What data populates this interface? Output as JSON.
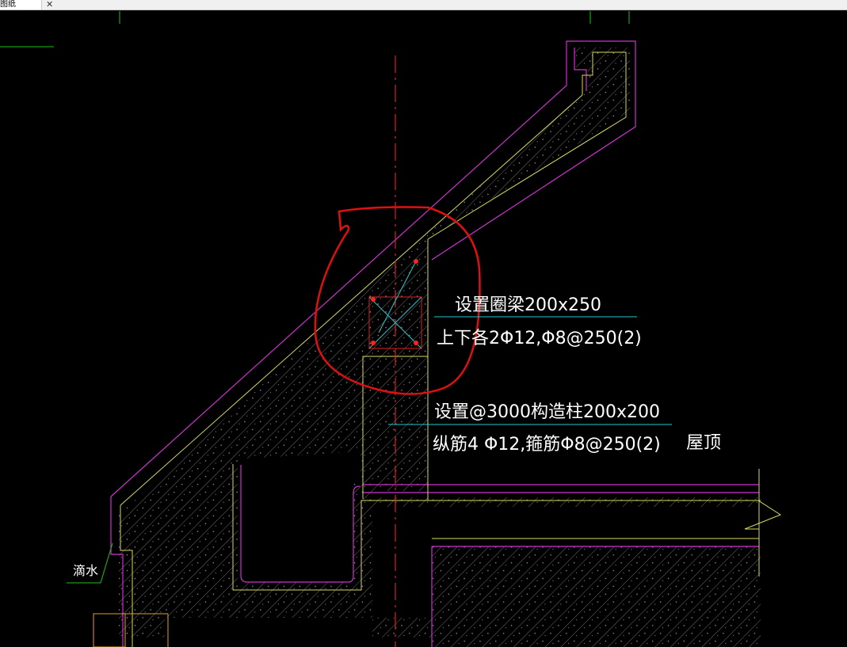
{
  "window": {
    "tab_label": "图纸",
    "tab_close": "✕"
  },
  "colors": {
    "background": "#000000",
    "outline": "#cc33cc",
    "inner_line": "#e0e060",
    "centerline": "#e02020",
    "leader": "#20c8d0",
    "markup": "#e01010",
    "hatch": "#7a7a7a",
    "text": "#ffffff",
    "green": "#20c020"
  },
  "annotations": {
    "ring_beam_line1": "设置圈梁200x250",
    "ring_beam_line2": "上下各2Φ12,Φ8@250(2)",
    "column_line1": "设置@3000构造柱200x200",
    "column_line2": "纵筋4 Φ12,箍筋Φ8@250(2)",
    "roof_label": "屋顶",
    "drip_label": "滴水"
  }
}
